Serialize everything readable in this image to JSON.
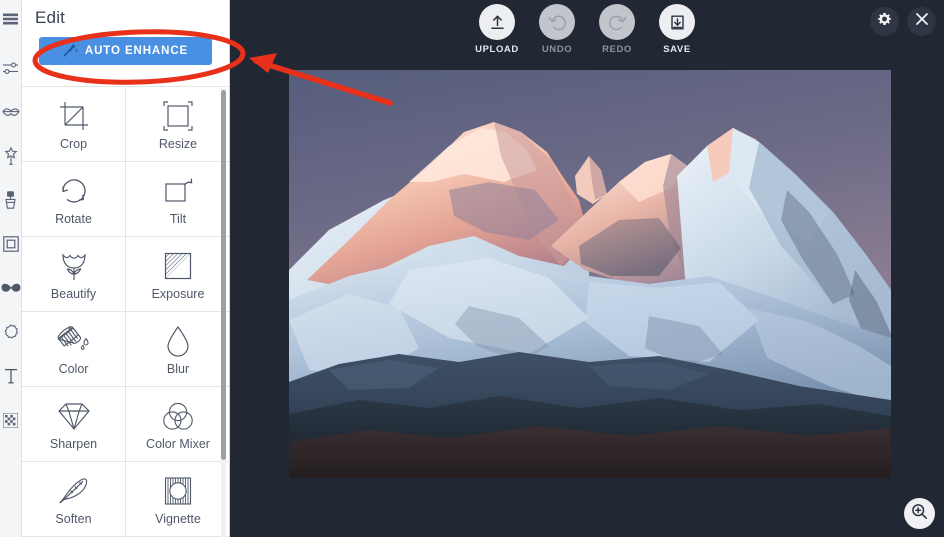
{
  "app": {
    "background_color": "#212733",
    "panel_background": "#ffffff",
    "accent_color": "#4a90e2",
    "annotation_color": "#e8301b"
  },
  "panel": {
    "title": "Edit",
    "auto_enhance_label": "AUTO ENHANCE",
    "auto_enhance_icon": "magic-wand-icon",
    "tools": [
      {
        "label": "Crop",
        "icon": "crop-icon"
      },
      {
        "label": "Resize",
        "icon": "resize-icon"
      },
      {
        "label": "Rotate",
        "icon": "rotate-icon"
      },
      {
        "label": "Tilt",
        "icon": "tilt-icon"
      },
      {
        "label": "Beautify",
        "icon": "flower-icon"
      },
      {
        "label": "Exposure",
        "icon": "exposure-icon"
      },
      {
        "label": "Color",
        "icon": "paint-bucket-icon"
      },
      {
        "label": "Blur",
        "icon": "droplet-icon"
      },
      {
        "label": "Sharpen",
        "icon": "diamond-icon"
      },
      {
        "label": "Color Mixer",
        "icon": "venn-circles-icon"
      },
      {
        "label": "Soften",
        "icon": "feather-icon"
      },
      {
        "label": "Vignette",
        "icon": "vignette-icon"
      }
    ]
  },
  "rail": {
    "items": [
      {
        "name": "menu",
        "icon": "hamburger-menu-icon"
      },
      {
        "name": "adjust",
        "icon": "sliders-icon"
      },
      {
        "name": "touch-up",
        "icon": "lips-icon"
      },
      {
        "name": "effects",
        "icon": "magic-wand-star-icon"
      },
      {
        "name": "paint",
        "icon": "brush-icon"
      },
      {
        "name": "frames",
        "icon": "frame-icon"
      },
      {
        "name": "stickers",
        "icon": "mustache-icon"
      },
      {
        "name": "overlays",
        "icon": "badge-flower-icon"
      },
      {
        "name": "text",
        "icon": "text-t-icon"
      },
      {
        "name": "texture",
        "icon": "checkered-grid-icon"
      }
    ]
  },
  "toolbar": {
    "items": [
      {
        "label": "UPLOAD",
        "icon": "upload-arrow-icon",
        "disabled": false
      },
      {
        "label": "UNDO",
        "icon": "undo-arrow-icon",
        "disabled": true
      },
      {
        "label": "REDO",
        "icon": "redo-arrow-icon",
        "disabled": true
      },
      {
        "label": "SAVE",
        "icon": "save-download-icon",
        "disabled": false
      }
    ]
  },
  "topright": {
    "settings_icon": "gear-icon",
    "close_icon": "close-x-icon"
  },
  "canvas": {
    "zoom_icon": "zoom-in-magnifier-icon",
    "photo_alt": "Snow-covered mountain range at sunset with pink alpenglow on the peaks"
  },
  "annotations": {
    "ellipse_target": "AUTO ENHANCE",
    "arrow_direction": "points-up-left-to-auto-enhance"
  }
}
